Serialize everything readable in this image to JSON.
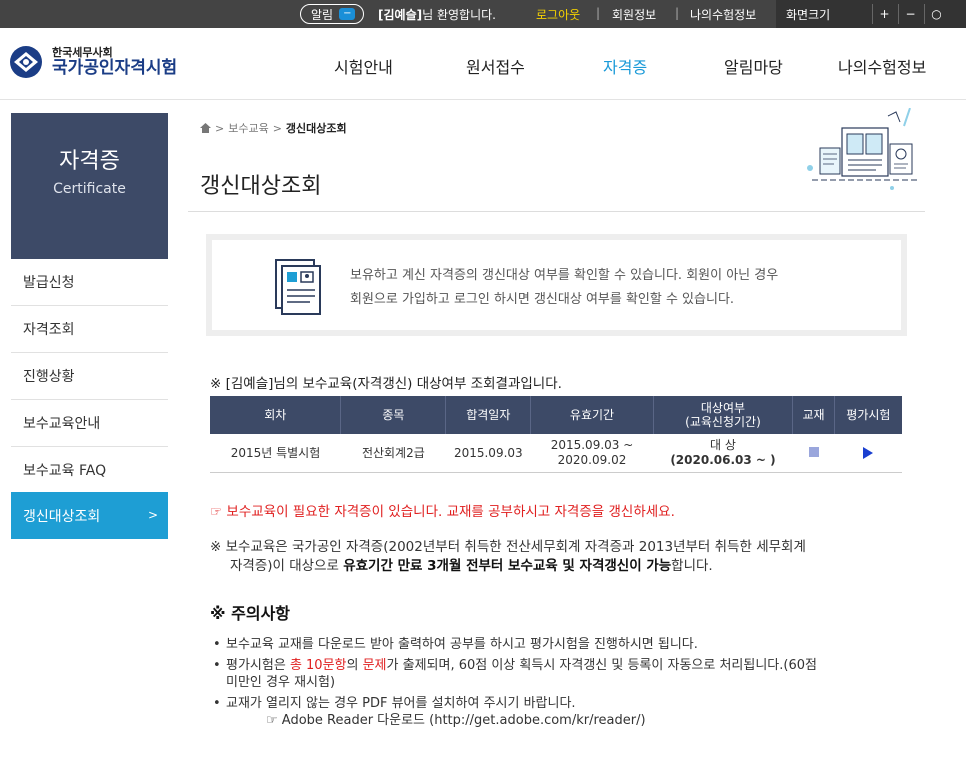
{
  "topbar": {
    "alert_label": "알림",
    "alert_toggle": "−",
    "user_name": "[김예슬]",
    "welcome_suffix": "님 환영합니다.",
    "logout": "로그아웃",
    "sep1": "|",
    "member_info": "회원정보",
    "sep2": "|",
    "my_exam_info": "나의수험정보",
    "zoom_label": "화면크기",
    "zoom_in": "+",
    "zoom_out": "−",
    "zoom_reset": "○"
  },
  "logo": {
    "org_small": "한국세무사회",
    "org_big": "국가공인자격시험"
  },
  "nav": [
    "시험안내",
    "원서접수",
    "자격증",
    "알림마당",
    "나의수험정보"
  ],
  "nav_active_index": 2,
  "sidebar": {
    "title_ko": "자격증",
    "title_en": "Certificate",
    "items": [
      "발급신청",
      "자격조회",
      "진행상황",
      "보수교육안내",
      "보수교육 FAQ",
      "갱신대상조회"
    ],
    "active_arrow": ">"
  },
  "breadcrumb": {
    "home_icon": "home-icon",
    "sep1": ">",
    "level1": "보수교육",
    "sep2": ">",
    "current": "갱신대상조회"
  },
  "page_title": "갱신대상조회",
  "infobox": {
    "line1": "보유하고 계신 자격증의 갱신대상 여부를 확인할 수 있습니다. 회원이 아닌 경우",
    "line2": "회원으로 가입하고 로그인 하시면 갱신대상 여부를 확인할 수 있습니다."
  },
  "result_title": "※ [김예슬]님의 보수교육(자격갱신) 대상여부 조회결과입니다.",
  "table": {
    "headers": {
      "round": "회차",
      "type": "종목",
      "pass_date": "합격일자",
      "valid_period": "유효기간",
      "target_top": "대상여부",
      "target_bottom": "(교육신청기간)",
      "textbook": "교재",
      "eval": "평가시험"
    },
    "row": {
      "round": "2015년 특별시험",
      "type": "전산회계2급",
      "pass_date": "2015.09.03",
      "valid_from": "2015.09.03 ~",
      "valid_to": "2020.09.02",
      "target": "대 상",
      "target_period": "(2020.06.03 ~ )",
      "textbook_icon": "book-icon",
      "eval_icon": "play-icon"
    }
  },
  "warning": "☞ 보수교육이 필요한 자격증이 있습니다. 교재를 공부하시고 자격증을 갱신하세요.",
  "note": {
    "line1": "※ 보수교육은 국가공인 자격증(2002년부터 취득한 전산세무회계 자격증과 2013년부터 취득한 세무회계",
    "line2_pre": "자격증)이 대상으로 ",
    "line2_bold": "유효기간 만료 3개월 전부터 보수교육 및 자격갱신이 가능",
    "line2_post": "합니다."
  },
  "caution": {
    "title": "※ 주의사항",
    "b1": "보수교육 교재를 다운로드 받아 출력하여 공부를 하시고 평가시험을 진행하시면 됩니다.",
    "b2_pre": "평가시험은 ",
    "b2_red1": "총 10문항",
    "b2_mid": "의 ",
    "b2_red2": "문제",
    "b2_post": "가 출제되며, 60점 이상 획득시 자격갱신 및 등록이 자동으로 처리됩니다.(60점",
    "b2_line2": "미만인 경우 재시험)",
    "b3": "교재가 열리지 않는 경우 PDF 뷰어를 설치하여 주시기 바랍니다.",
    "b3_link": "☞ Adobe Reader 다운로드 (http://get.adobe.com/kr/reader/)",
    "bullet": "•"
  },
  "colors": {
    "accent": "#1e9ed4",
    "navy": "#3d4a67",
    "warning": "#e02020",
    "logout": "#f5d200"
  }
}
